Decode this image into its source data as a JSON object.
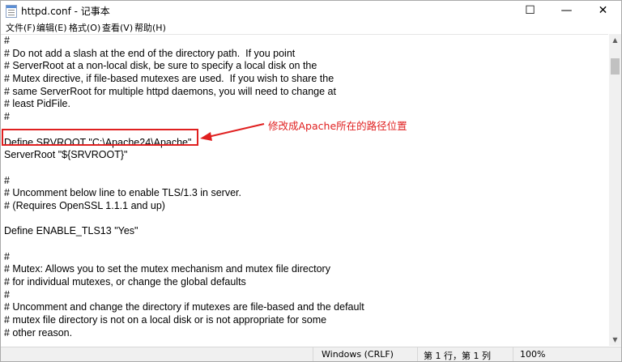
{
  "window": {
    "title": "httpd.conf - 记事本",
    "controls": {
      "minimize": "—",
      "maximize": "☐",
      "close": "✕"
    }
  },
  "menu": [
    {
      "label": "文件(F)"
    },
    {
      "label": "编辑(E)"
    },
    {
      "label": "格式(O)"
    },
    {
      "label": "查看(V)"
    },
    {
      "label": "帮助(H)"
    }
  ],
  "editor": {
    "lines": [
      "#",
      "# Do not add a slash at the end of the directory path.  If you point",
      "# ServerRoot at a non-local disk, be sure to specify a local disk on the",
      "# Mutex directive, if file-based mutexes are used.  If you wish to share the",
      "# same ServerRoot for multiple httpd daemons, you will need to change at",
      "# least PidFile.",
      "#",
      "",
      "Define SRVROOT \"C:\\Apache24\\Apache\"",
      "ServerRoot \"${SRVROOT}\"",
      "",
      "#",
      "# Uncomment below line to enable TLS/1.3 in server.",
      "# (Requires OpenSSL 1.1.1 and up)",
      "",
      "Define ENABLE_TLS13 \"Yes\"",
      "",
      "#",
      "# Mutex: Allows you to set the mutex mechanism and mutex file directory",
      "# for individual mutexes, or change the global defaults",
      "#",
      "# Uncomment and change the directory if mutexes are file-based and the default",
      "# mutex file directory is not on a local disk or is not appropriate for some",
      "# other reason."
    ]
  },
  "annotation": {
    "text": "修改成Apache所在的路径位置",
    "color": "#e02020"
  },
  "statusbar": {
    "line_ending": "Windows (CRLF)",
    "position": "第 1 行，第 1 列",
    "zoom": "100%"
  },
  "icons": {
    "app": "notepad-icon",
    "scroll_up": "scroll-up-arrow-icon",
    "scroll_down": "scroll-down-arrow-icon"
  }
}
